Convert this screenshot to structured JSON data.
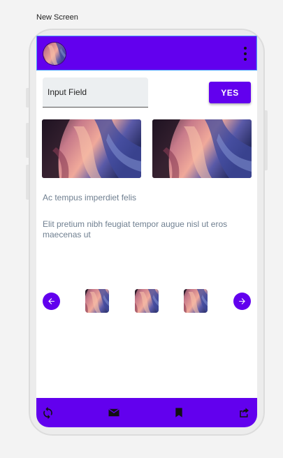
{
  "screen_label": "New Screen",
  "colors": {
    "primary": "#6200ee",
    "text_muted": "#6f7f90",
    "input_bg": "#eceff1"
  },
  "topbar": {
    "avatar_icon": "canyon-photo",
    "menu_icon": "more-vertical-icon"
  },
  "form": {
    "input_placeholder": "Input Field",
    "button_label": "YES"
  },
  "content": {
    "text1": "Ac tempus imperdiet felis",
    "text2": "Elit pretium nibh feugiat tempor augue nisl ut eros maecenas ut"
  },
  "carousel": {
    "prev_icon": "arrow-left-icon",
    "next_icon": "arrow-right-icon",
    "thumb_count": 3
  },
  "bottom_nav": {
    "icons": [
      "refresh-icon",
      "mail-icon",
      "bookmark-icon",
      "share-icon"
    ]
  }
}
